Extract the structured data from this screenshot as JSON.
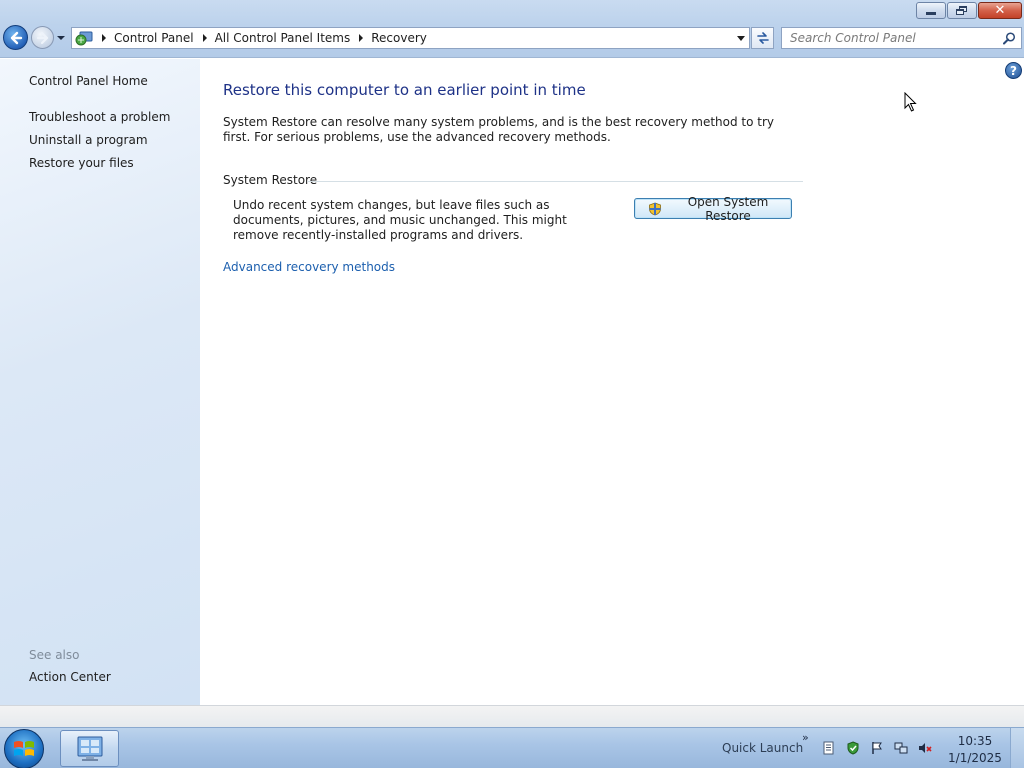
{
  "window": {
    "controls": {
      "minimize": "minimize",
      "maximize": "restore",
      "close": "close"
    }
  },
  "address": {
    "breadcrumbs": [
      "Control Panel",
      "All Control Panel Items",
      "Recovery"
    ]
  },
  "search": {
    "placeholder": "Search Control Panel"
  },
  "sidebar": {
    "home": "Control Panel Home",
    "links": [
      "Troubleshoot a problem",
      "Uninstall a program",
      "Restore your files"
    ],
    "see_also_label": "See also",
    "see_also_links": [
      "Action Center"
    ]
  },
  "main": {
    "title": "Restore this computer to an earlier point in time",
    "intro": "System Restore can resolve many system problems, and is the best recovery method to try first. For serious problems, use the advanced recovery methods.",
    "section_title": "System Restore",
    "section_desc": "Undo recent system changes, but leave files such as documents, pictures, and music unchanged. This might remove recently-installed programs and drivers.",
    "open_button": "Open System Restore",
    "advanced_link": "Advanced recovery methods",
    "help": "?"
  },
  "taskbar": {
    "quick_launch": "Quick Launch",
    "time": "10:35",
    "date": "1/1/2025"
  },
  "colors": {
    "title_blue": "#1e3287",
    "link_blue": "#1c5fae",
    "sidebar_bg": "#dce8f6",
    "taskbar_bg": "#a9c5e6"
  },
  "icons": [
    "back-icon",
    "forward-icon",
    "control-panel-icon",
    "refresh-icon",
    "search-icon",
    "help-icon",
    "shield-icon",
    "windows-logo-icon",
    "cursor-icon"
  ]
}
